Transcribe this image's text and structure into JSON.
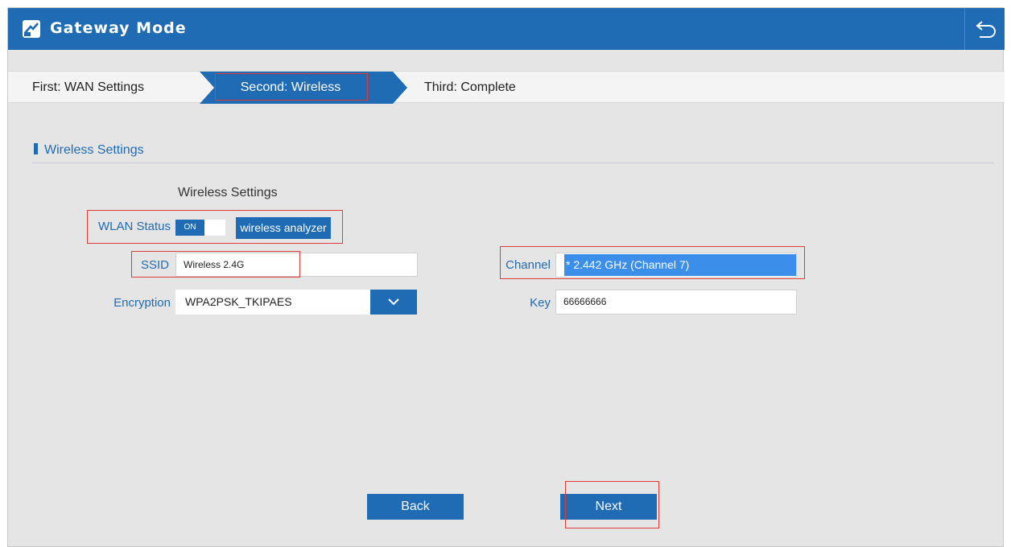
{
  "header": {
    "title": "Gateway Mode",
    "logo_icon": "router-logo-icon",
    "back_icon": "return-arrow-icon",
    "color": "#1f6cb5"
  },
  "steps": [
    {
      "label": "First: WAN Settings",
      "active": false
    },
    {
      "label": "Second: Wireless",
      "active": true
    },
    {
      "label": "Third: Complete",
      "active": false
    }
  ],
  "section": {
    "title": "Wireless Settings",
    "subtitle": "Wireless Settings"
  },
  "form": {
    "wlan_status": {
      "label": "WLAN Status",
      "toggle_text": "ON",
      "button_label": "wireless analyzer"
    },
    "ssid": {
      "label": "SSID",
      "value": "Wireless 2.4G"
    },
    "encryption": {
      "label": "Encryption",
      "value": "WPA2PSK_TKIPAES",
      "dropdown_icon": "chevron-down-icon"
    },
    "channel": {
      "label": "Channel",
      "value": "* 2.442 GHz (Channel 7)"
    },
    "key": {
      "label": "Key",
      "value": "66666666"
    }
  },
  "buttons": {
    "back": "Back",
    "next": "Next"
  },
  "colors": {
    "accent": "#1f6cb5",
    "highlight": "#e03a3a",
    "selection": "#3b8eea"
  }
}
